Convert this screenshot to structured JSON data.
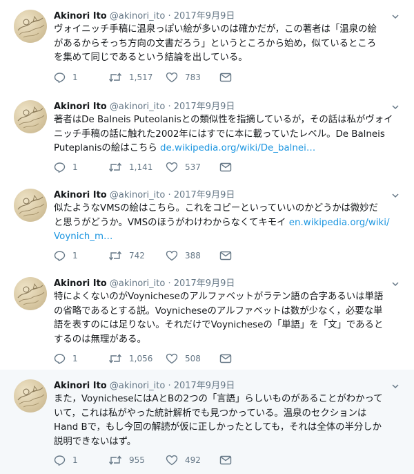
{
  "tweets": [
    {
      "name": "Akinori Ito",
      "handle": "@akinori_ito",
      "sep": "·",
      "date": "2017年9月9日",
      "lines": [
        "ヴォイニッチ手稿に温泉っぽい絵が多いのは確かだが，この著者は「温泉の絵",
        "があるからそっち方向の文書だろう」というところから始め，似ているところ",
        "を集めて同じであるという結論を出している。"
      ],
      "link": "",
      "replies": "1",
      "retweets": "1,517",
      "likes": "783"
    },
    {
      "name": "Akinori Ito",
      "handle": "@akinori_ito",
      "sep": "·",
      "date": "2017年9月9日",
      "lines": [
        "著者はDe Balneis Puteolanisとの類似性を指摘しているが，その話は私がヴォイ",
        "ニッチ手稿の話に触れた2002年にはすでに本に載っていたレベル。De Balneis",
        "Puteplanisの絵はこちら "
      ],
      "link": "de.wikipedia.org/wiki/De_balnei…",
      "replies": "1",
      "retweets": "1,141",
      "likes": "537"
    },
    {
      "name": "Akinori Ito",
      "handle": "@akinori_ito",
      "sep": "·",
      "date": "2017年9月9日",
      "lines": [
        "似たようなVMSの絵はこちら。これをコピーといっていいのかどうかは微妙だ",
        "と思うがどうか。VMSのほうがわけわからなくてキモイ "
      ],
      "link": "en.wikipedia.org/wiki/Voynich_m…",
      "replies": "1",
      "retweets": "742",
      "likes": "388"
    },
    {
      "name": "Akinori Ito",
      "handle": "@akinori_ito",
      "sep": "·",
      "date": "2017年9月9日",
      "lines": [
        "特によくないのがVoynicheseのアルファベットがラテン語の合字あるいは単語",
        "の省略であるとする説。Voynicheseのアルファベットは数が少なく，必要な単",
        "語を表すのには足りない。それだけでVoynicheseの「単語」を「文」であると",
        "するのは無理がある。"
      ],
      "link": "",
      "replies": "1",
      "retweets": "1,056",
      "likes": "508"
    },
    {
      "name": "Akinori Ito",
      "handle": "@akinori_ito",
      "sep": "·",
      "date": "2017年9月9日",
      "lines": [
        "また，VoynicheseにはAとBの2つの「言語」らしいものがあることがわかって",
        "いて，これは私がやった統計解析でも見つかっている。温泉のセクションは",
        "Hand Bで，もし今回の解読が仮に正しかったとしても，それは全体の半分しか",
        "説明できないはず。"
      ],
      "link": "",
      "replies": "1",
      "retweets": "955",
      "likes": "492"
    }
  ],
  "colors": {
    "link": "#1b95e0",
    "meta": "#657786",
    "thread": "#ccd6dd",
    "highlight_bg": "#f5f8fa"
  },
  "icons": [
    "chevron-down-icon",
    "reply-icon",
    "retweet-icon",
    "like-icon",
    "message-icon"
  ]
}
